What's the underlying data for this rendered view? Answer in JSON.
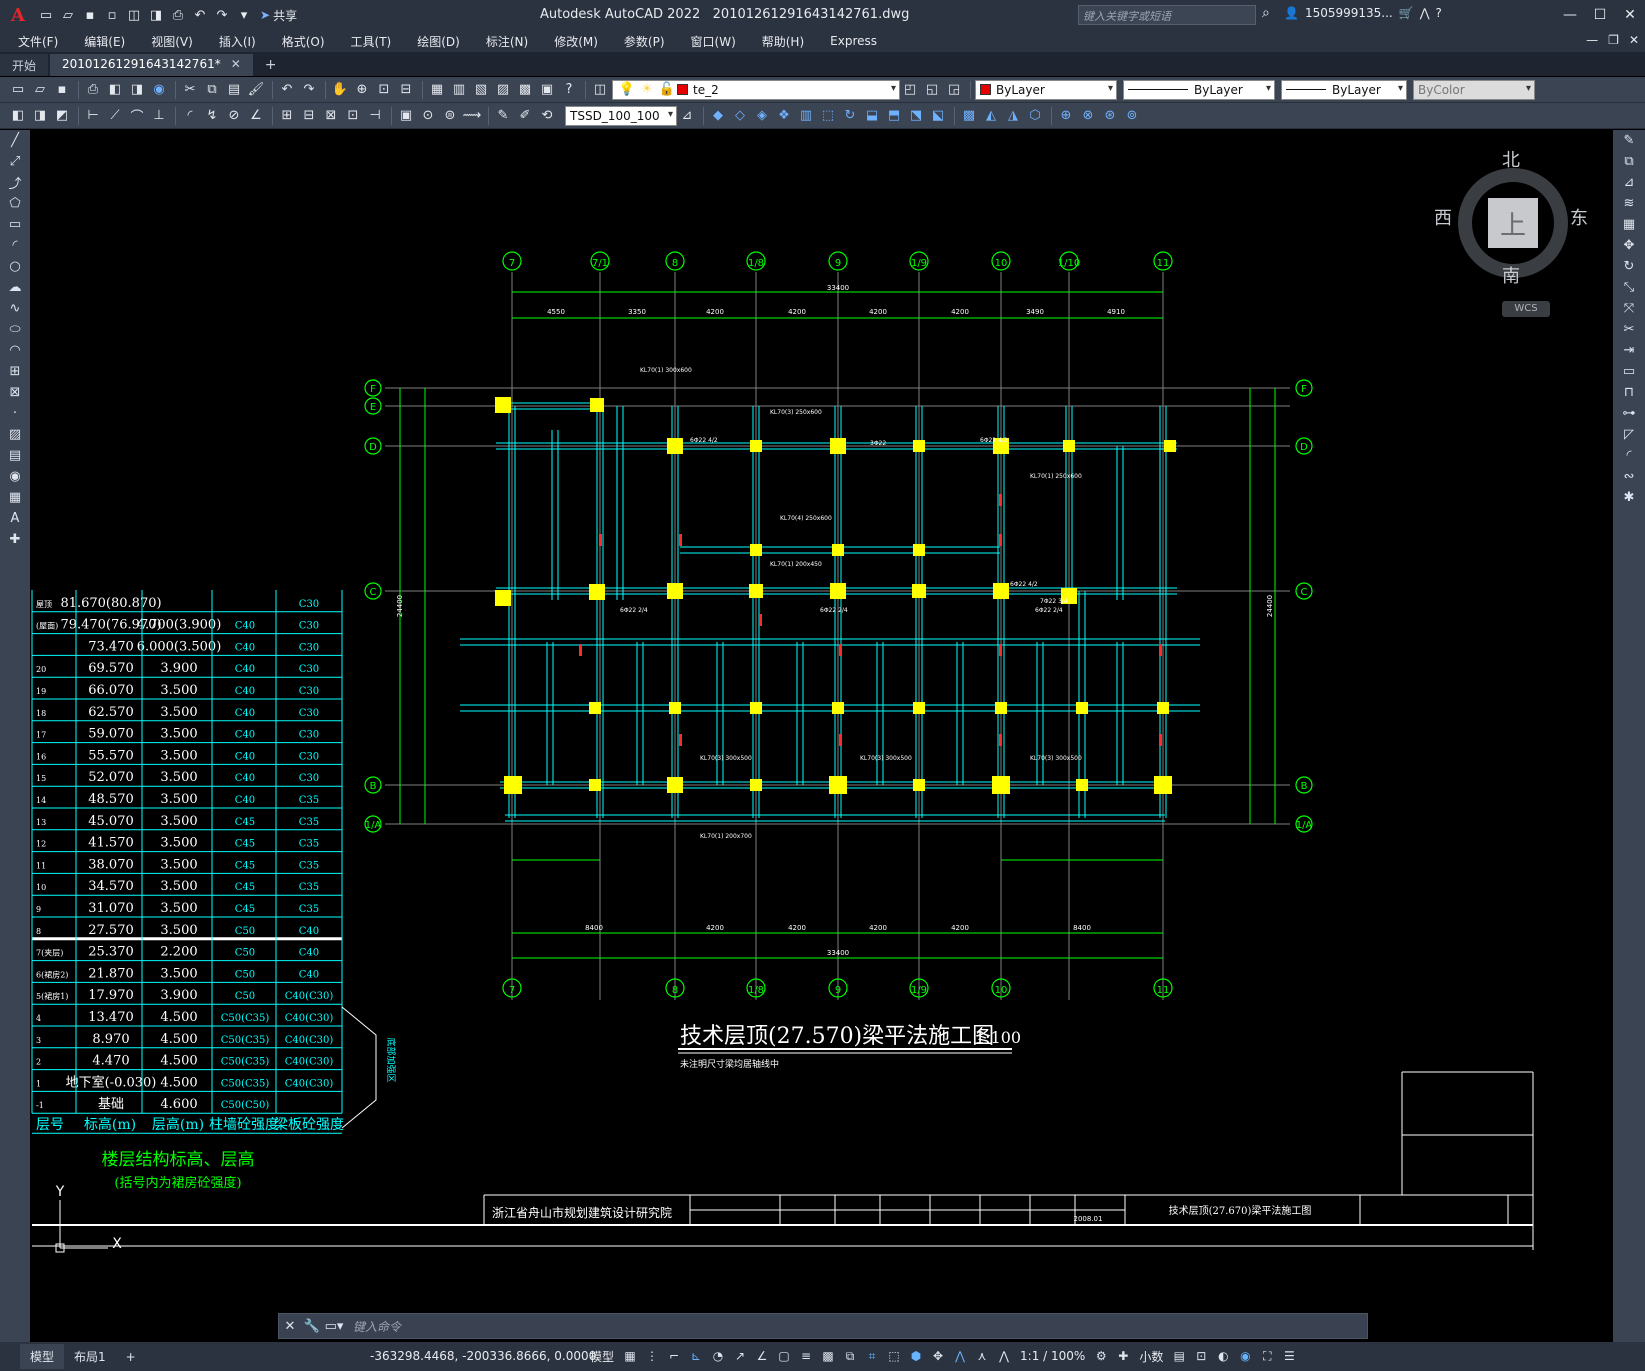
{
  "app": {
    "logo": "A",
    "title": "Autodesk AutoCAD 2022",
    "filename": "20101261291643142761.dwg",
    "search_placeholder": "键入关键字或短语",
    "user": "1505999135...",
    "share_label": "共享"
  },
  "menu": {
    "items": [
      "文件(F)",
      "编辑(E)",
      "视图(V)",
      "插入(I)",
      "格式(O)",
      "工具(T)",
      "绘图(D)",
      "标注(N)",
      "修改(M)",
      "参数(P)",
      "窗口(W)",
      "帮助(H)",
      "Express"
    ]
  },
  "tabs": {
    "start": "开始",
    "doc": "20101261291643142761*",
    "close": "✕",
    "add": "+"
  },
  "toolbar": {
    "layer_name": "te_2",
    "color": "ByLayer",
    "linetype": "ByLayer",
    "lineweight": "ByLayer",
    "plotstyle": "ByColor",
    "dimstyle": "TSSD_100_100"
  },
  "viewcube": {
    "north": "北",
    "south": "南",
    "east": "东",
    "west": "西",
    "face": "上",
    "wcs": "WCS"
  },
  "drawing": {
    "title": "技术层顶(27.570)梁平法施工图",
    "scale": "1:100",
    "note": "未注明尺寸梁均居轴线中",
    "axes_top": [
      "7",
      "7/1",
      "8",
      "1/8",
      "9",
      "1/9",
      "10",
      "1/10",
      "11"
    ],
    "axes_bottom": [
      "7",
      "8",
      "1/8",
      "9",
      "1/9",
      "10",
      "11"
    ],
    "axes_left": [
      "F",
      "E",
      "D",
      "C",
      "B",
      "1/A"
    ],
    "total_dim_top": "33400",
    "total_dim_bottom": "33400",
    "top_dims": [
      "4550",
      "3350",
      "4200",
      "4200",
      "4200",
      "4200",
      "3490",
      "4910"
    ],
    "bottom_dims": [
      "8400",
      "4200",
      "4200",
      "4200",
      "4200",
      "8400"
    ],
    "left_dim": "24400",
    "right_dim": "24400",
    "institute": "浙江省舟山市规划建筑设计研究院",
    "sheet_title": "技术层顶(27.670)梁平法施工图",
    "date": "2008.01"
  },
  "floor_table": {
    "title": "楼层结构标高、层高",
    "subtitle": "(括号内为裙房砼强度)",
    "headers": [
      "层号",
      "标高(m)",
      "层高(m)",
      "柱墙砼强度",
      "梁板砼强度"
    ],
    "side_label": "底部加强区",
    "rows": [
      [
        "屋顶",
        "81.670(80.870)",
        "",
        "",
        "C30"
      ],
      [
        "(屋面)",
        "79.470(76.970)",
        "4.700(3.900)",
        "C40",
        "C30"
      ],
      [
        "",
        "73.470",
        "6.000(3.500)",
        "C40",
        "C30"
      ],
      [
        "20",
        "69.570",
        "3.900",
        "C40",
        "C30"
      ],
      [
        "19",
        "66.070",
        "3.500",
        "C40",
        "C30"
      ],
      [
        "18",
        "62.570",
        "3.500",
        "C40",
        "C30"
      ],
      [
        "17",
        "59.070",
        "3.500",
        "C40",
        "C30"
      ],
      [
        "16",
        "55.570",
        "3.500",
        "C40",
        "C30"
      ],
      [
        "15",
        "52.070",
        "3.500",
        "C40",
        "C30"
      ],
      [
        "14",
        "48.570",
        "3.500",
        "C40",
        "C35"
      ],
      [
        "13",
        "45.070",
        "3.500",
        "C45",
        "C35"
      ],
      [
        "12",
        "41.570",
        "3.500",
        "C45",
        "C35"
      ],
      [
        "11",
        "38.070",
        "3.500",
        "C45",
        "C35"
      ],
      [
        "10",
        "34.570",
        "3.500",
        "C45",
        "C35"
      ],
      [
        "9",
        "31.070",
        "3.500",
        "C45",
        "C35"
      ],
      [
        "8",
        "27.570",
        "3.500",
        "C50",
        "C40"
      ],
      [
        "7(夹层)",
        "25.370",
        "2.200",
        "C50",
        "C40"
      ],
      [
        "6(裙房2)",
        "21.870",
        "3.500",
        "C50",
        "C40"
      ],
      [
        "5(裙房1)",
        "17.970",
        "3.900",
        "C50",
        "C40(C30)"
      ],
      [
        "4",
        "13.470",
        "4.500",
        "C50(C35)",
        "C40(C30)"
      ],
      [
        "3",
        "8.970",
        "4.500",
        "C50(C35)",
        "C40(C30)"
      ],
      [
        "2",
        "4.470",
        "4.500",
        "C50(C35)",
        "C40(C30)"
      ],
      [
        "1",
        "地下室(-0.030)",
        "4.500",
        "C50(C35)",
        "C40(C30)"
      ],
      [
        "-1",
        "基础",
        "4.600",
        "C50(C50)",
        ""
      ]
    ]
  },
  "ucs": {
    "y": "Y",
    "x": "X"
  },
  "command": {
    "placeholder": "键入命令"
  },
  "status": {
    "model_tab": "模型",
    "layout_tab": "布局1",
    "add": "+",
    "coords": "-363298.4468, -200336.8666, 0.0000",
    "model": "模型",
    "scale": "1:1 / 100%",
    "units": "小数"
  },
  "colors": {
    "frame": "#00ff00",
    "beam": "#00ffff",
    "column": "#ffff00",
    "text": "#ffffff",
    "axis": "#00ff00",
    "red": "#ff2a2a"
  }
}
